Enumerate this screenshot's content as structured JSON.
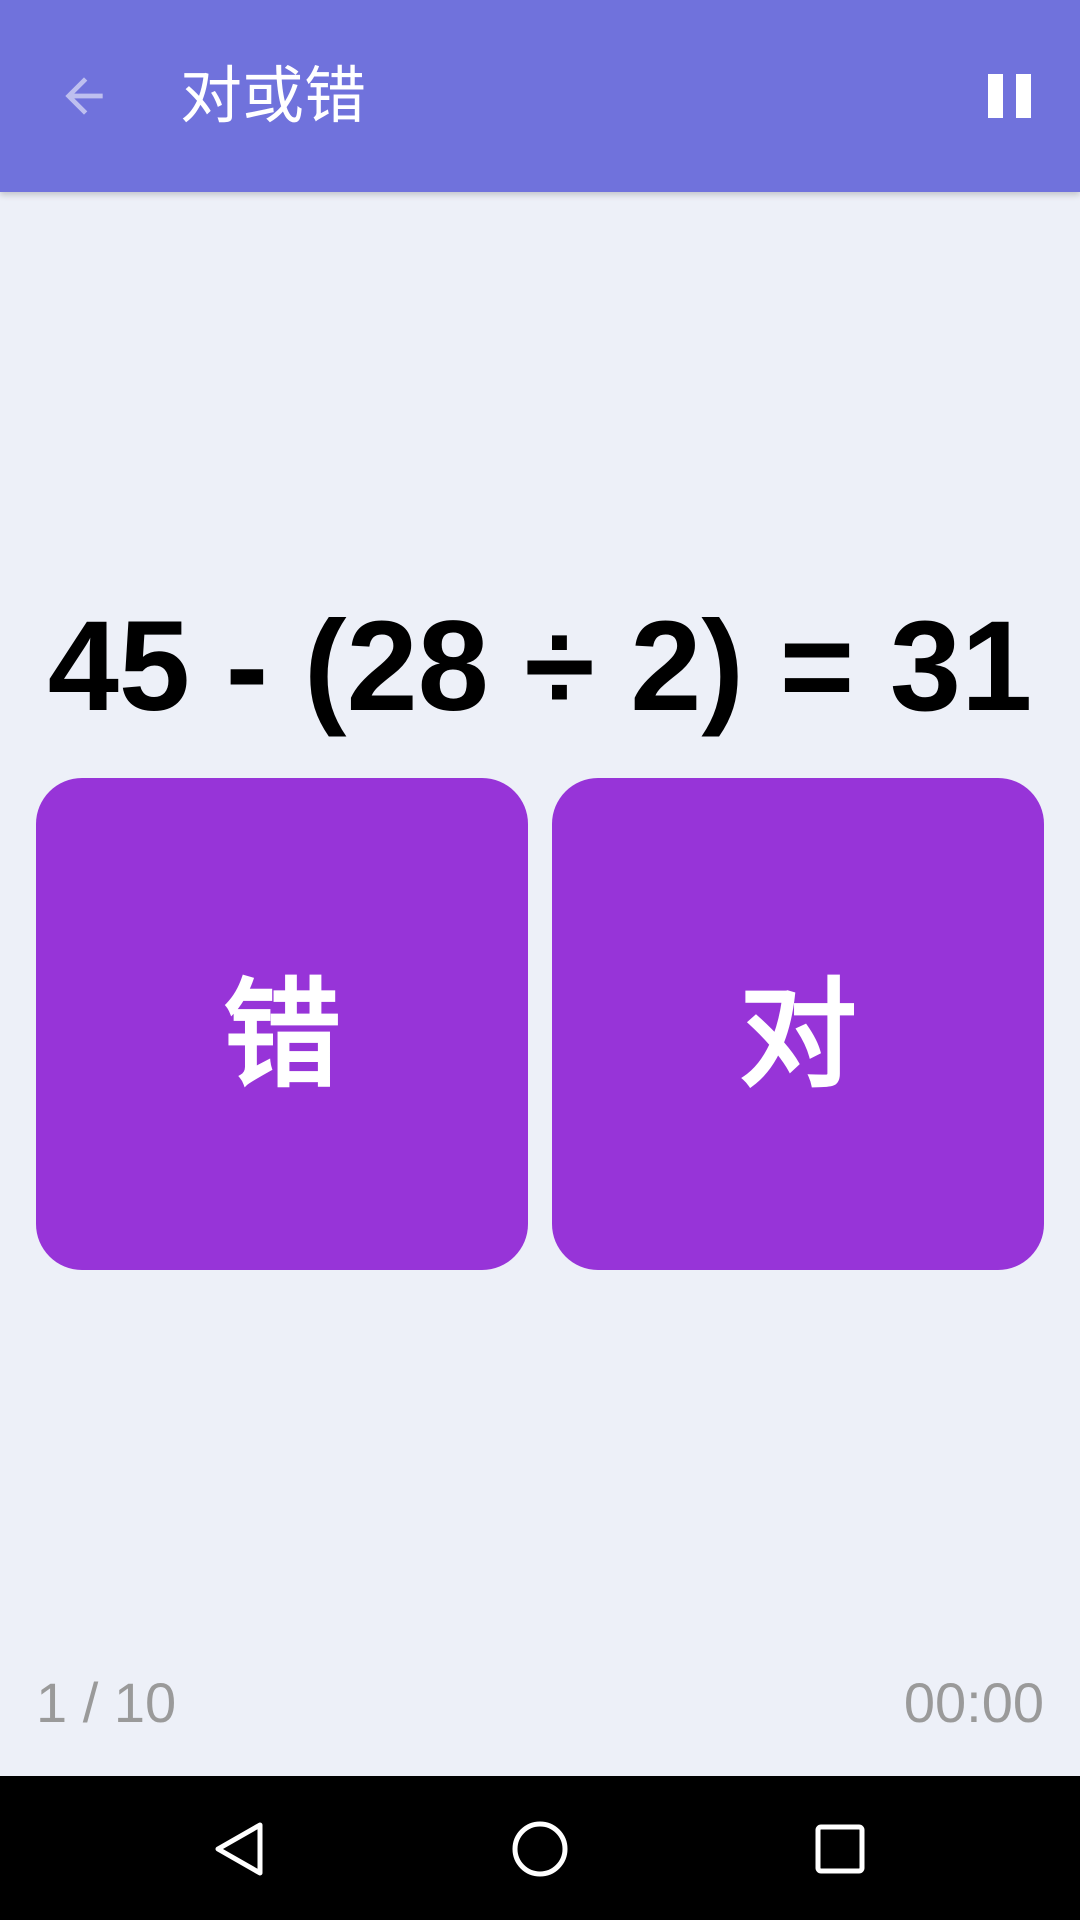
{
  "app_bar": {
    "title": "对或错",
    "back_icon": "arrow-back-icon",
    "pause_icon": "pause-icon",
    "background_color": "#7072dc"
  },
  "quiz": {
    "expression": "45 - (28 ÷ 2) = 31",
    "false_label": "错",
    "true_label": "对",
    "button_color": "#9734d8"
  },
  "footer": {
    "progress": "1 / 10",
    "timer": "00:00"
  },
  "system_nav": {
    "back_icon": "triangle-back-icon",
    "home_icon": "circle-home-icon",
    "recents_icon": "square-recents-icon"
  }
}
